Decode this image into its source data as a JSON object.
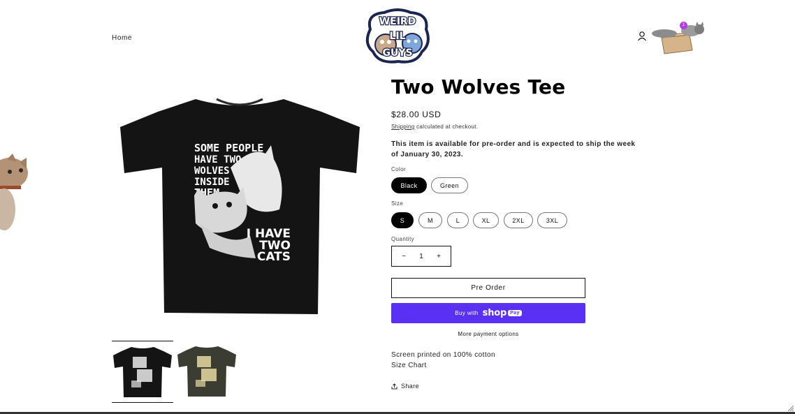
{
  "header": {
    "nav_home": "Home",
    "logo_lines": [
      "WEIRD",
      "LIL",
      "GUYS"
    ],
    "cart_count": "1"
  },
  "product": {
    "title": "Two Wolves Tee",
    "price": "$28.00 USD",
    "shipping_link": "Shipping",
    "shipping_rest": " calculated at checkout.",
    "preorder_note": "This item is available for pre-order and is expected to ship the week of January 30, 2023.",
    "shirt_text_top": [
      "SOME PEOPLE",
      "HAVE TWO",
      "WOLVES",
      "INSIDE",
      "THEM..."
    ],
    "shirt_text_bottom": [
      "I HAVE",
      "TWO",
      "CATS"
    ]
  },
  "options": {
    "color_label": "Color",
    "colors": [
      "Black",
      "Green"
    ],
    "color_selected": "Black",
    "size_label": "Size",
    "sizes": [
      "S",
      "M",
      "L",
      "XL",
      "2XL",
      "3XL"
    ],
    "size_selected": "S",
    "quantity_label": "Quantity",
    "quantity": "1",
    "minus": "−",
    "plus": "+"
  },
  "actions": {
    "preorder": "Pre Order",
    "buy_with": "Buy with",
    "shop_word": "shop",
    "pay_word": "Pay",
    "more_payment": "More payment options",
    "share": "Share"
  },
  "details": {
    "material": "Screen printed on 100% cotton",
    "size_chart": "Size Chart"
  },
  "colors": {
    "accent_shoppay": "#5a31f4",
    "cart_badge": "#b53de3",
    "text": "#121212"
  }
}
